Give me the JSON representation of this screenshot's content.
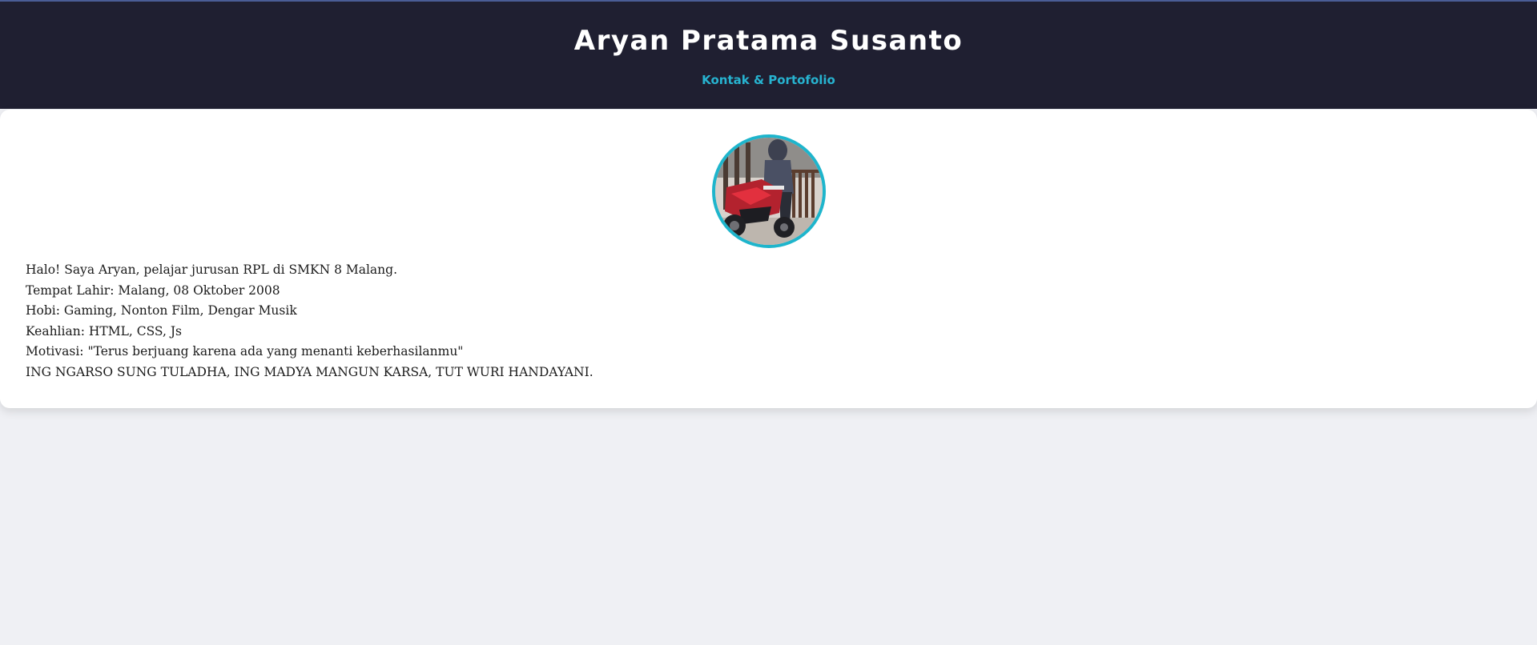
{
  "header": {
    "title": "Aryan Pratama Susanto",
    "subtitle_link": "Kontak & Portofolio"
  },
  "profile": {
    "photo_icon": "profile-photo-motorcycle",
    "bio_lines": [
      "Halo! Saya Aryan, pelajar jurusan RPL di SMKN 8 Malang.",
      "Tempat Lahir: Malang, 08 Oktober 2008",
      "Hobi: Gaming, Nonton Film, Dengar Musik",
      "Keahlian: HTML, CSS, Js",
      "Motivasi: \"Terus berjuang karena ada yang menanti keberhasilanmu\"",
      "ING NGARSO SUNG TULADHA, ING MADYA MANGUN KARSA, TUT WURI HANDAYANI."
    ]
  },
  "colors": {
    "header_bg": "#1f1f31",
    "accent": "#27b3d0",
    "page_bg": "#eff0f4",
    "card_bg": "#ffffff"
  }
}
